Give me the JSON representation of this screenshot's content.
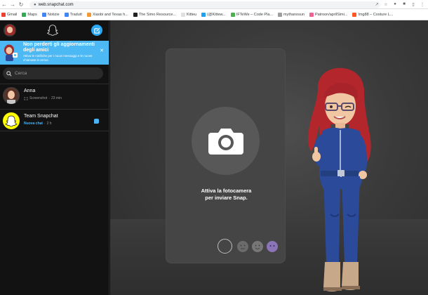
{
  "browser": {
    "url": "web.snapchat.com",
    "bookmarks": [
      {
        "label": "Gmail",
        "color": "#ea4335"
      },
      {
        "label": "Maps",
        "color": "#34a853"
      },
      {
        "label": "Notizie",
        "color": "#4285f4"
      },
      {
        "label": "Tradutt",
        "color": "#4285f4"
      },
      {
        "label": "Xiaobi and Texas h...",
        "color": "#f09a36"
      },
      {
        "label": "The Simo Resource...",
        "color": "#222222"
      },
      {
        "label": "Kitteu",
        "color": "#e0e0e0"
      },
      {
        "label": "(@Kittew...",
        "color": "#1da1f2"
      },
      {
        "label": "IFTeWe – Code Pla...",
        "color": "#4caf50"
      },
      {
        "label": "mythanosun",
        "color": "#9e9e9e"
      },
      {
        "label": "Patroon/aprilSimi...",
        "color": "#f06292"
      },
      {
        "label": "Img88 – Costure L...",
        "color": "#ff5722"
      }
    ]
  },
  "sidebar": {
    "notification": {
      "title": "Non perderti gli aggiornamenti degli amici",
      "subtitle": "Attiva le notifiche per i nuovi messaggi e le nuove chiamate in arrivo."
    },
    "search": {
      "placeholder": "Cerca"
    },
    "chats": [
      {
        "name": "Anna",
        "status": "Screenshot",
        "time": "23 min",
        "status_color": "#9a9a9a"
      },
      {
        "name": "Team Snapchat",
        "status": "Nuova chat",
        "time": "2 h",
        "status_color": "#4bb4f5"
      }
    ]
  },
  "main": {
    "camera_prompt": "Attiva la fotocamera\nper inviare Snap."
  },
  "colors": {
    "accent_blue": "#2aa9f5",
    "snap_yellow": "#fffc00",
    "notification_bg": "#4cb8f4"
  }
}
